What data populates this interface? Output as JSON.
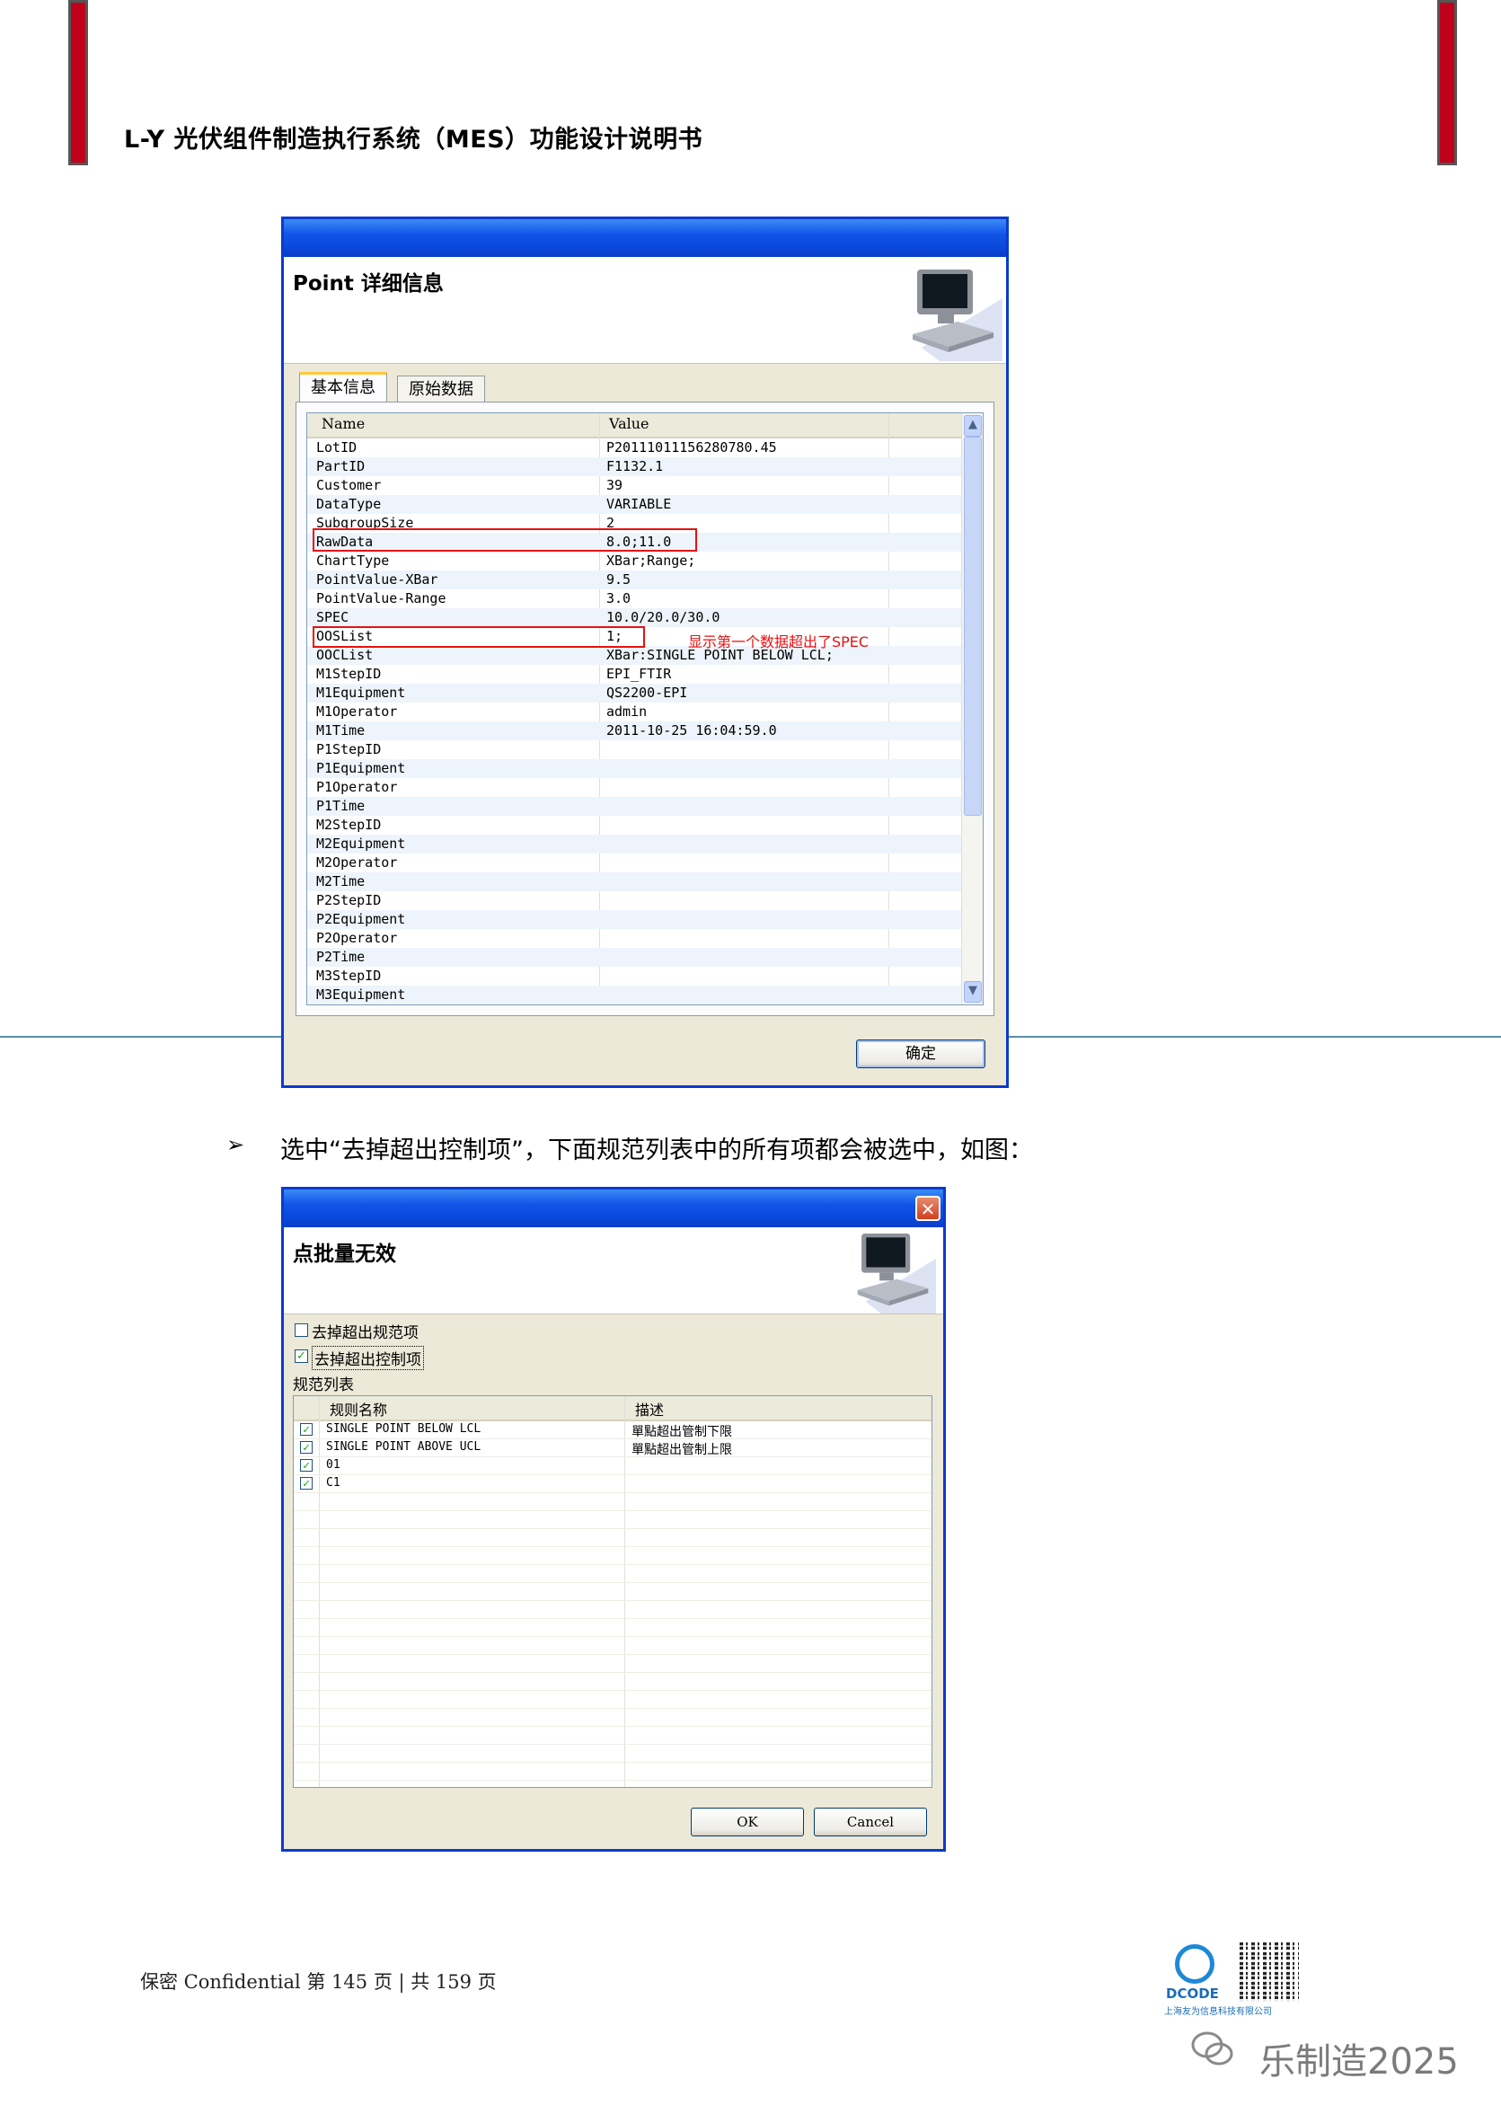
{
  "doc_header": {
    "title": "L-Y 光伏组件制造执行系统（MES）功能设计说明书"
  },
  "dialog1": {
    "title": "Point 详细信息",
    "tabs": [
      "基本信息",
      "原始数据"
    ],
    "columns": [
      "Name",
      "Value"
    ],
    "rows": [
      {
        "name": "LotID",
        "value": "P20111011156280780.45"
      },
      {
        "name": "PartID",
        "value": "F1132.1"
      },
      {
        "name": "Customer",
        "value": "39"
      },
      {
        "name": "DataType",
        "value": "VARIABLE"
      },
      {
        "name": "SubgroupSize",
        "value": "2"
      },
      {
        "name": "RawData",
        "value": "8.0;11.0"
      },
      {
        "name": "ChartType",
        "value": "XBar;Range;"
      },
      {
        "name": "PointValue-XBar",
        "value": "9.5"
      },
      {
        "name": "PointValue-Range",
        "value": "3.0"
      },
      {
        "name": "SPEC",
        "value": "10.0/20.0/30.0"
      },
      {
        "name": "OOSList",
        "value": "1;"
      },
      {
        "name": "OOCList",
        "value": "XBar:SINGLE POINT BELOW LCL;"
      },
      {
        "name": "M1StepID",
        "value": "EPI_FTIR"
      },
      {
        "name": "M1Equipment",
        "value": "QS2200-EPI"
      },
      {
        "name": "M1Operator",
        "value": "admin"
      },
      {
        "name": "M1Time",
        "value": "2011-10-25 16:04:59.0"
      },
      {
        "name": "P1StepID",
        "value": ""
      },
      {
        "name": "P1Equipment",
        "value": ""
      },
      {
        "name": "P1Operator",
        "value": ""
      },
      {
        "name": "P1Time",
        "value": ""
      },
      {
        "name": "M2StepID",
        "value": ""
      },
      {
        "name": "M2Equipment",
        "value": ""
      },
      {
        "name": "M2Operator",
        "value": ""
      },
      {
        "name": "M2Time",
        "value": ""
      },
      {
        "name": "P2StepID",
        "value": ""
      },
      {
        "name": "P2Equipment",
        "value": ""
      },
      {
        "name": "P2Operator",
        "value": ""
      },
      {
        "name": "P2Time",
        "value": ""
      },
      {
        "name": "M3StepID",
        "value": ""
      },
      {
        "name": "M3Equipment",
        "value": ""
      }
    ],
    "annotation": "显示第一个数据超出了SPEC",
    "ok_label": "确定"
  },
  "instruction": {
    "bullet": "➢",
    "text": "选中“去掉超出控制项”，下面规范列表中的所有项都会被选中，如图："
  },
  "dialog2": {
    "title": "点批量无效",
    "close_glyph": "✕",
    "check1_label": "去掉超出规范项",
    "check2_label": "去掉超出控制项",
    "list_label": "规范列表",
    "columns": [
      "规则名称",
      "描述"
    ],
    "rows": [
      {
        "name": "SINGLE POINT BELOW LCL",
        "desc": "單點超出管制下限",
        "checked": true
      },
      {
        "name": "SINGLE POINT ABOVE UCL",
        "desc": "單點超出管制上限",
        "checked": true
      },
      {
        "name": "01",
        "desc": "",
        "checked": true
      },
      {
        "name": "C1",
        "desc": "",
        "checked": true
      }
    ],
    "ok_label": "OK",
    "cancel_label": "Cancel"
  },
  "footer": {
    "text": "保密 Confidential 第 145 页 | 共 159 页",
    "logo_text": "DCODE",
    "logo_sub": "上海友为信息科技有限公司",
    "watermark": "乐制造2025"
  }
}
